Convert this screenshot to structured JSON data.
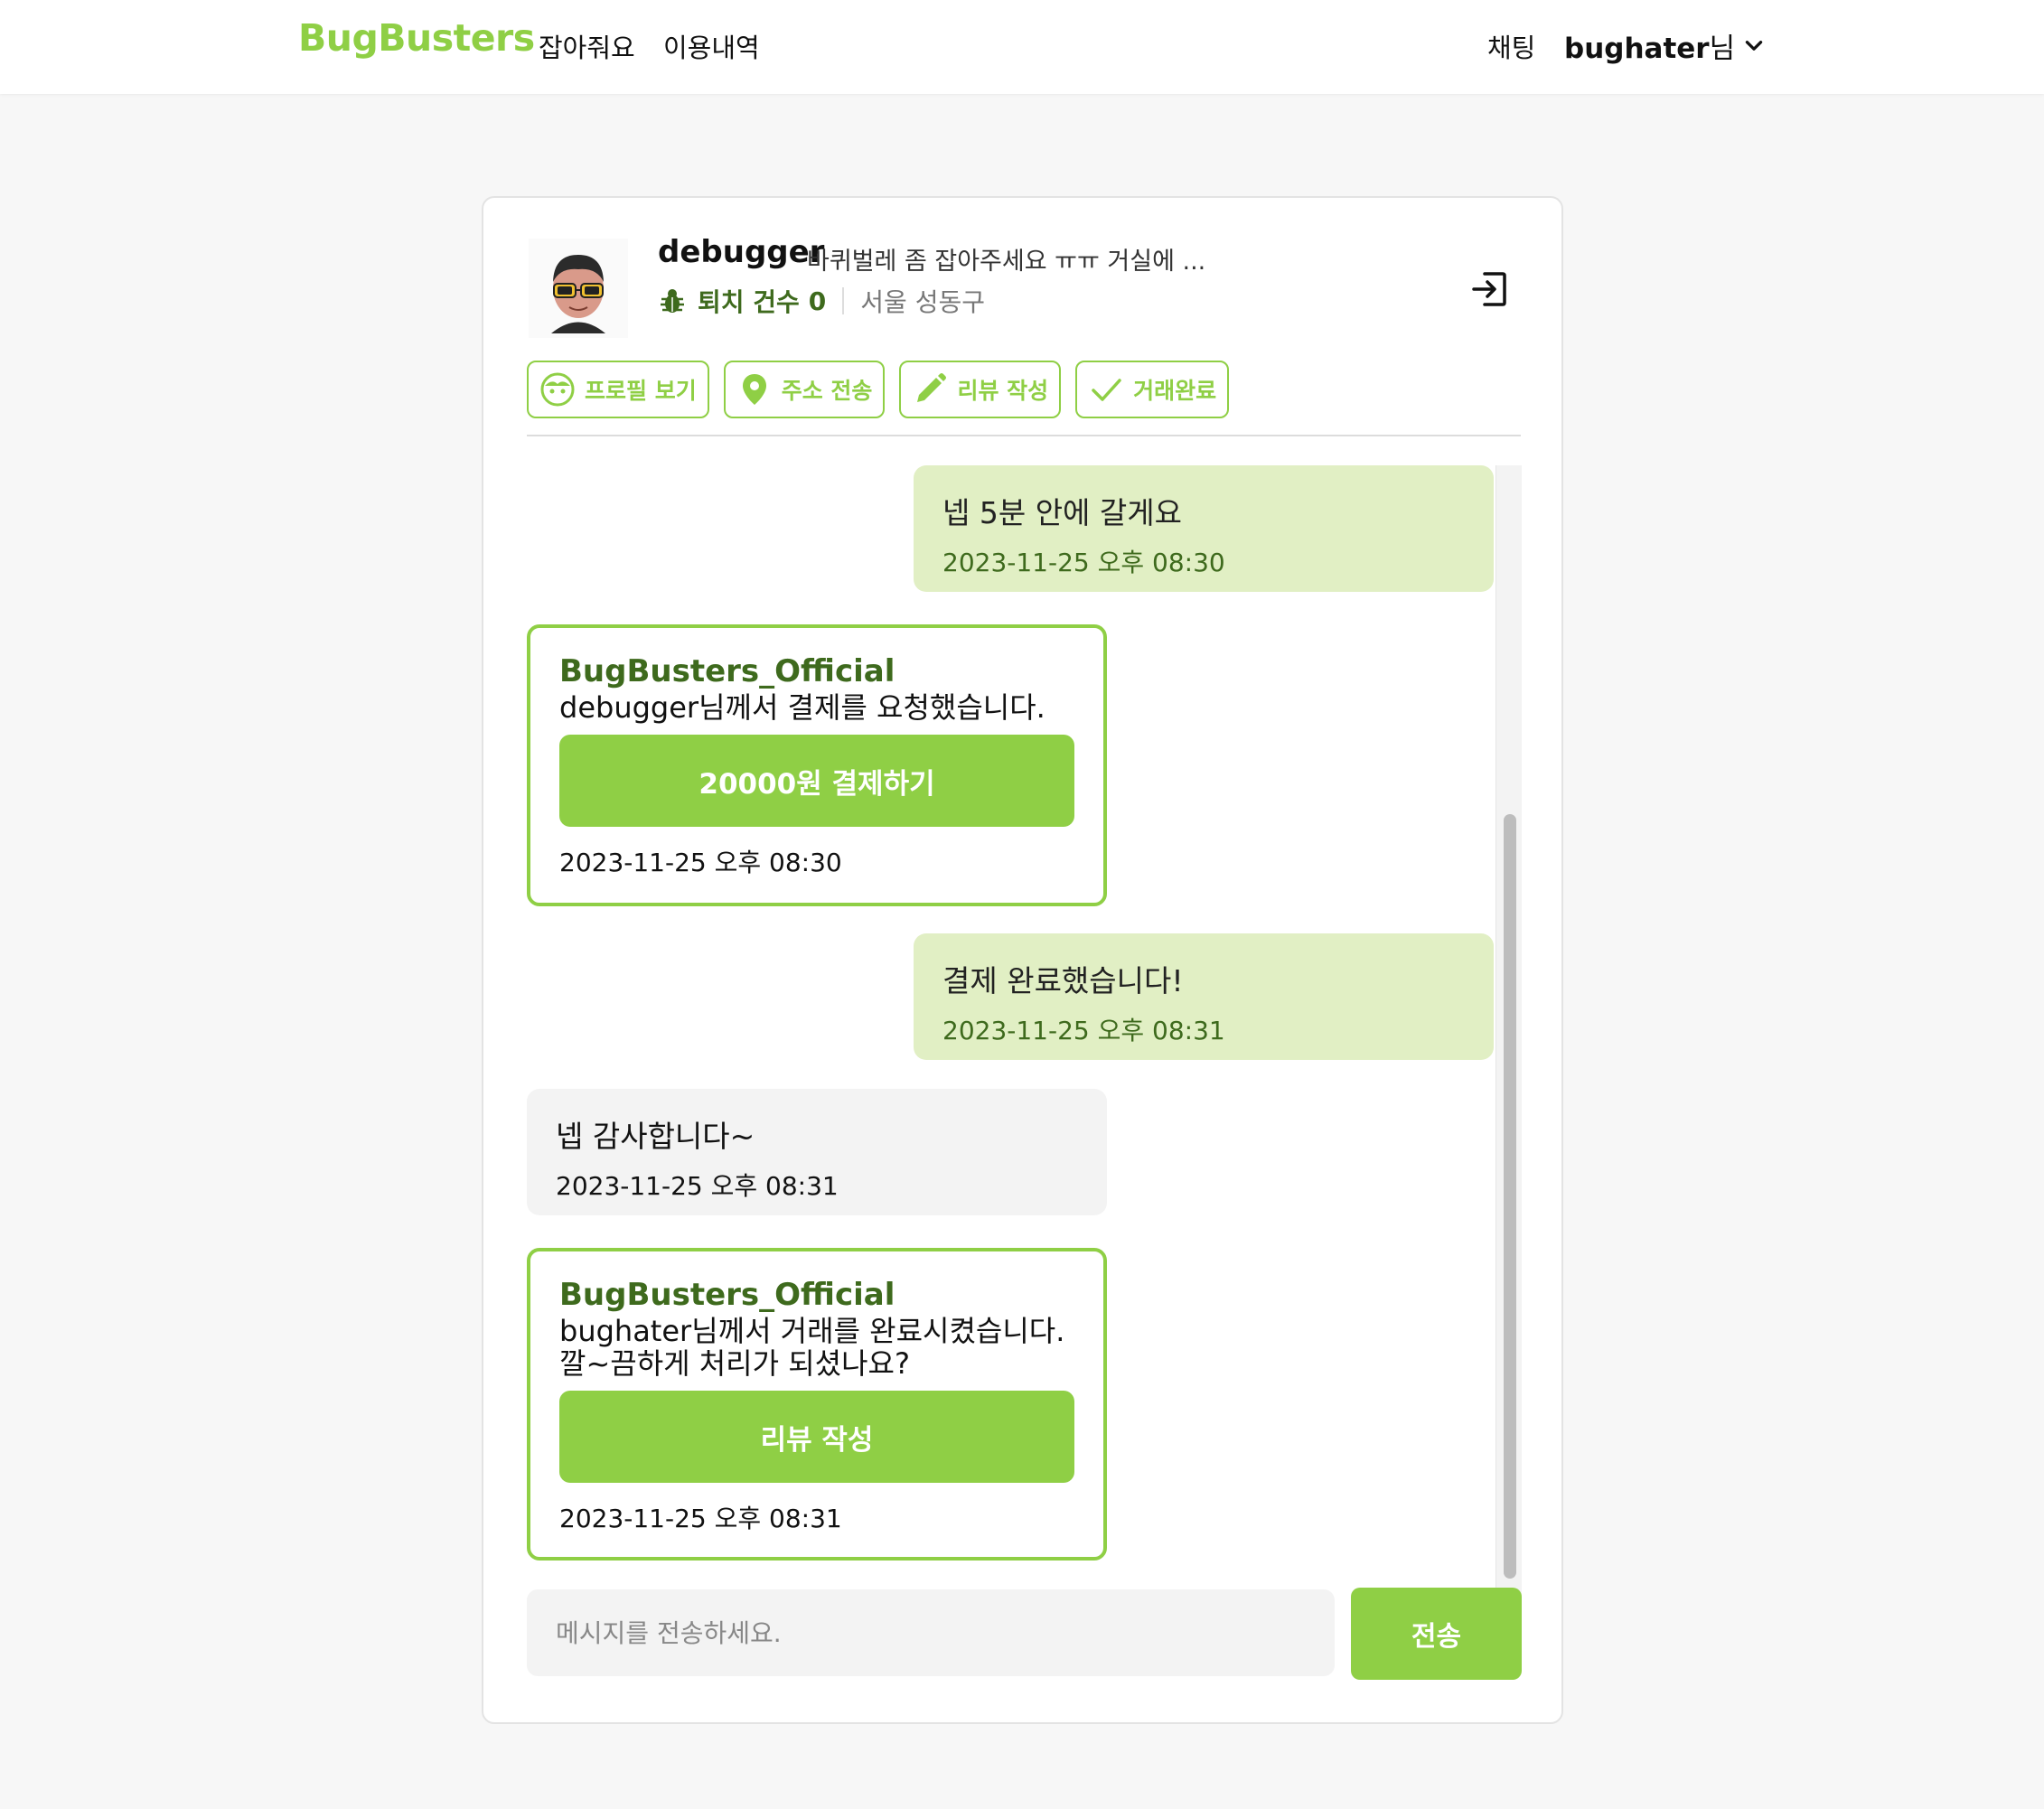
{
  "header": {
    "logo": "BugBusters",
    "nav": [
      "잡아줘요",
      "이용내역"
    ],
    "chat_link": "채팅",
    "user_name": "bughater",
    "user_suffix": "님"
  },
  "peer": {
    "name": "debugger",
    "description": "바퀴벌레 좀 잡아주세요 ㅠㅠ 거실에 ...",
    "stat_label": "퇴치 건수",
    "stat_count": "0",
    "location": "서울 성동구"
  },
  "actions": [
    {
      "label": "프로필 보기",
      "icon": "face-icon"
    },
    {
      "label": "주소 전송",
      "icon": "location-pin-icon"
    },
    {
      "label": "리뷰 작성",
      "icon": "pencil-icon"
    },
    {
      "label": "거래완료",
      "icon": "check-icon"
    }
  ],
  "messages": [
    {
      "type": "mine",
      "text": "넵 5분 안에 갈게요",
      "time": "2023-11-25 오후 08:30"
    },
    {
      "type": "system",
      "sender": "BugBusters_Official",
      "text": "debugger님께서 결제를 요청했습니다.",
      "button": "20000원 결제하기",
      "time": "2023-11-25 오후 08:30"
    },
    {
      "type": "mine",
      "text": "결제 완료했습니다!",
      "time": "2023-11-25 오후 08:31"
    },
    {
      "type": "theirs",
      "text": "넵 감사합니다~",
      "time": "2023-11-25 오후 08:31"
    },
    {
      "type": "system",
      "sender": "BugBusters_Official",
      "text_line1": "bughater님께서 거래를 완료시켰습니다.",
      "text_line2": "깔~끔하게 처리가 되셨나요?",
      "button": "리뷰 작성",
      "time": "2023-11-25 오후 08:31"
    }
  ],
  "composer": {
    "placeholder": "메시지를 전송하세요.",
    "send_label": "전송"
  },
  "colors": {
    "accent": "#8fcf45",
    "accent_dark": "#3e6a1d",
    "my_bubble": "#e1efc4",
    "their_bubble": "#f3f3f3"
  }
}
